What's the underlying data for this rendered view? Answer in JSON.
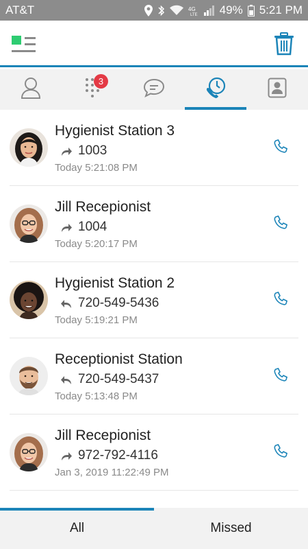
{
  "status_bar": {
    "carrier": "AT&T",
    "battery": "49%",
    "time": "5:21 PM",
    "network": "4G LTE"
  },
  "colors": {
    "accent": "#1b84b8",
    "badge": "#e43a45",
    "menu_green": "#2ecc71",
    "status_bar": "#8c8c8c"
  },
  "tabs": [
    {
      "icon": "contact-icon"
    },
    {
      "icon": "dialpad-icon",
      "badge": "3"
    },
    {
      "icon": "chat-icon"
    },
    {
      "icon": "recent-calls-icon",
      "active": true
    },
    {
      "icon": "directory-icon"
    }
  ],
  "calls": [
    {
      "name": "Hygienist Station 3",
      "number": "1003",
      "direction": "outgoing",
      "time": "Today 5:21:08 PM"
    },
    {
      "name": "Jill Recepionist",
      "number": "1004",
      "direction": "outgoing",
      "time": "Today 5:20:17 PM"
    },
    {
      "name": "Hygienist Station 2",
      "number": "720-549-5436",
      "direction": "incoming",
      "time": "Today 5:19:21 PM"
    },
    {
      "name": "Receptionist Station",
      "number": "720-549-5437",
      "direction": "incoming",
      "time": "Today 5:13:48 PM"
    },
    {
      "name": "Jill Recepionist",
      "number": "972-792-4116",
      "direction": "outgoing",
      "time": "Jan 3, 2019 11:22:49 PM"
    }
  ],
  "filters": {
    "all": "All",
    "missed": "Missed",
    "selected": "All"
  }
}
